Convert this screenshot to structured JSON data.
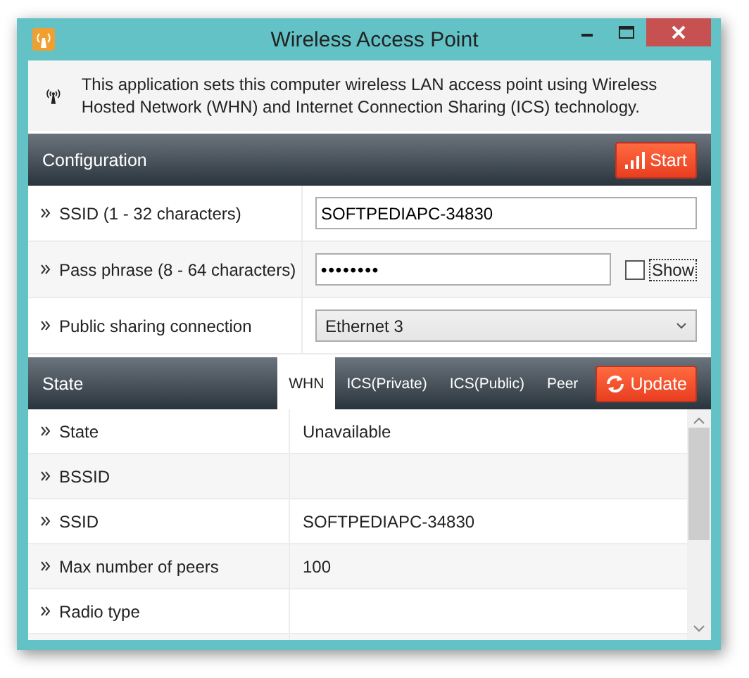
{
  "window": {
    "title": "Wireless Access Point"
  },
  "banner": {
    "text": "This application sets this computer wireless LAN access point using Wireless Hosted Network (WHN) and Internet Connection Sharing (ICS) technology."
  },
  "configuration": {
    "title": "Configuration",
    "start_button": "Start",
    "rows": [
      {
        "kind": "text",
        "label": "SSID (1 - 32 characters)",
        "value": "SOFTPEDIAPC-34830"
      },
      {
        "kind": "password",
        "label": "Pass phrase (8 - 64 characters)",
        "value": "••••••••",
        "show_label": "Show",
        "show_checked": false
      },
      {
        "kind": "select",
        "label": "Public sharing connection",
        "value": "Ethernet 3"
      }
    ]
  },
  "state": {
    "title": "State",
    "update_button": "Update",
    "tabs": [
      {
        "label": "WHN",
        "selected": true
      },
      {
        "label": "ICS(Private)",
        "selected": false
      },
      {
        "label": "ICS(Public)",
        "selected": false
      },
      {
        "label": "Peer",
        "selected": false
      }
    ],
    "rows": [
      {
        "label": "State",
        "value": "Unavailable"
      },
      {
        "label": "BSSID",
        "value": ""
      },
      {
        "label": "SSID",
        "value": "SOFTPEDIAPC-34830"
      },
      {
        "label": "Max number of peers",
        "value": "100"
      },
      {
        "label": "Radio type",
        "value": ""
      }
    ]
  }
}
